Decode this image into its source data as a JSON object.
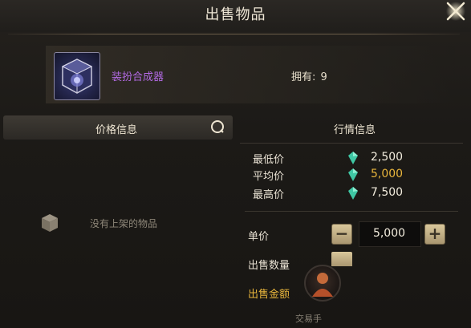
{
  "header": {
    "title": "出售物品"
  },
  "item": {
    "name": "装扮合成器",
    "owned_label": "拥有:",
    "owned_count": "9"
  },
  "left_panel": {
    "tab_label": "价格信息",
    "empty_text": "没有上架的物品"
  },
  "market": {
    "tab_label": "行情信息",
    "rows": [
      {
        "label": "最低价",
        "value": "2,500",
        "color": "#f2ecdd"
      },
      {
        "label": "平均价",
        "value": "5,000",
        "color": "#e8b53c"
      },
      {
        "label": "最高价",
        "value": "7,500",
        "color": "#f2ecdd"
      }
    ]
  },
  "form": {
    "unit_price_label": "单价",
    "unit_price_value": "5,000",
    "quantity_label": "出售数量",
    "amount_label": "出售金额",
    "trade_text": "交易手"
  },
  "colors": {
    "item_name": "#b26ae3",
    "gold": "#e8b53c",
    "gem": "#3fc7a4"
  }
}
